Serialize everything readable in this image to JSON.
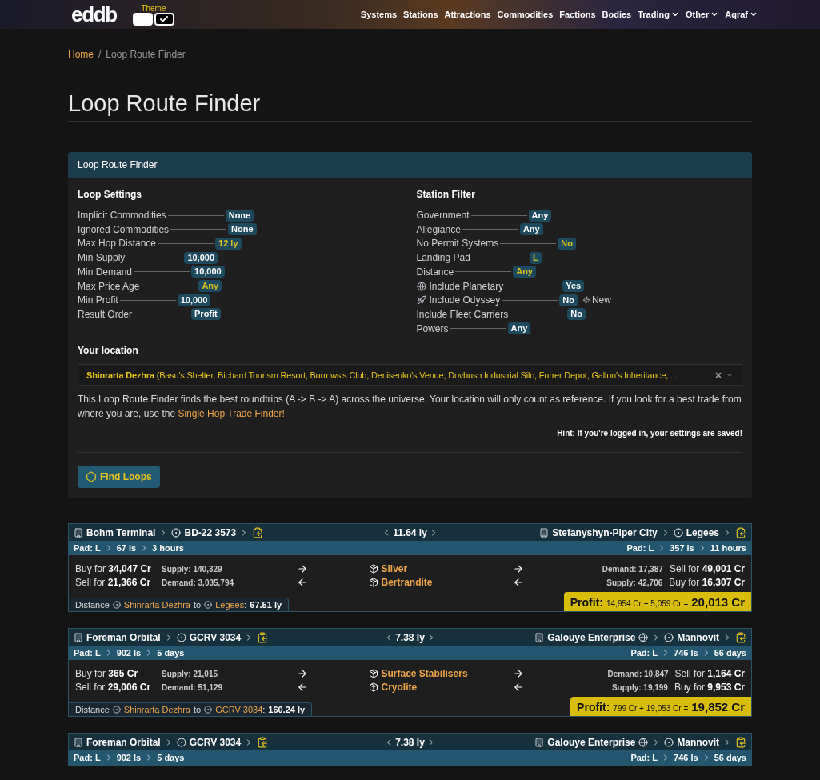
{
  "navbar": {
    "logo": "eddb",
    "theme": {
      "label": "Theme",
      "options": [
        {
          "selected": false
        },
        {
          "selected": true
        }
      ]
    },
    "items": [
      {
        "label": "Systems",
        "dropdown": false
      },
      {
        "label": "Stations",
        "dropdown": false
      },
      {
        "label": "Attractions",
        "dropdown": false
      },
      {
        "label": "Commodities",
        "dropdown": false
      },
      {
        "label": "Factions",
        "dropdown": false
      },
      {
        "label": "Bodies",
        "dropdown": false
      },
      {
        "label": "Trading",
        "dropdown": true
      },
      {
        "label": "Other",
        "dropdown": true
      },
      {
        "label": "Aqraf",
        "dropdown": true
      }
    ]
  },
  "breadcrumb": {
    "home": "Home",
    "separator": "/",
    "current": "Loop Route Finder"
  },
  "page_title": "Loop Route Finder",
  "panel": {
    "title": "Loop Route Finder",
    "loop_settings": {
      "heading": "Loop Settings",
      "rows": [
        {
          "label": "Implicit Commodities",
          "value": "None",
          "highlight": false
        },
        {
          "label": "Ignored Commodities",
          "value": "None",
          "highlight": false
        },
        {
          "label": "Max Hop Distance",
          "value": "12 ly",
          "highlight": true
        },
        {
          "label": "Min Supply",
          "value": "10,000",
          "highlight": false
        },
        {
          "label": "Min Demand",
          "value": "10,000",
          "highlight": false
        },
        {
          "label": "Max Price Age",
          "value": "Any",
          "highlight": true
        },
        {
          "label": "Min Profit",
          "value": "10,000",
          "highlight": false
        },
        {
          "label": "Result Order",
          "value": "Profit",
          "highlight": false
        }
      ]
    },
    "station_filter": {
      "heading": "Station Filter",
      "rows": [
        {
          "label": "Government",
          "value": "Any",
          "highlight": false
        },
        {
          "label": "Allegiance",
          "value": "Any",
          "highlight": false
        },
        {
          "label": "No Permit Systems",
          "value": "No",
          "highlight": true
        },
        {
          "label": "Landing Pad",
          "value": "L",
          "highlight": true
        },
        {
          "label": "Distance",
          "value": "Any",
          "highlight": true
        },
        {
          "label": "Include Planetary",
          "value": "Yes",
          "highlight": false,
          "kind": "planetary"
        },
        {
          "label": "Include Odyssey",
          "value": "No",
          "highlight": false,
          "kind": "odyssey",
          "note": "New"
        },
        {
          "label": "Include Fleet Carriers",
          "value": "No",
          "highlight": false
        },
        {
          "label": "Powers",
          "value": "Any",
          "highlight": false
        }
      ]
    },
    "location": {
      "label": "Your location",
      "value": "**Shinrarta Dezhra** (Basu's Shelter, Bichard Tourism Resort, Burrows's Club, Denisenko's Venue, Dovbush Industrial Silo, Furrer Depot, Gallun's Inheritance, ..."
    },
    "description": "This Loop Route Finder finds the best roundtrips (A -> B -> A) across the universe. Your location will only count as reference. If you look for a best trade from where you are, use the",
    "description_link": "Single Hop Trade Finder!",
    "hint": "Hint: If you're logged in, your settings are saved!",
    "button": "Find Loops"
  },
  "routes": [
    {
      "from": {
        "station": "Bohm Terminal",
        "planetary": false,
        "system": "BD-22 3573",
        "pad": "Pad: L",
        "distance": "67 ls",
        "age": "3 hours"
      },
      "hop": "11.64 ly",
      "to": {
        "station": "Stefanyshyn-Piper City",
        "planetary": false,
        "system": "Legees",
        "pad": "Pad: L",
        "distance": "357 ls",
        "age": "11 hours"
      },
      "trades": [
        {
          "left_price": "Buy for **34,047 Cr**",
          "left_stock": "Supply: 140,329",
          "commodity": "Silver",
          "right_stock": "Demand: 17,387",
          "right_price": "Sell for **49,001 Cr**"
        },
        {
          "left_price": "Sell for **21,366 Cr**",
          "left_stock": "Demand: 3,035,794",
          "commodity": "Bertrandite",
          "right_stock": "Supply: 42,706",
          "right_price": "Buy for **16,307 Cr**"
        }
      ],
      "reference": {
        "label": "Distance",
        "from": "Shinrarta Dezhra",
        "word": "to",
        "to": "Legees",
        "separator": ":",
        "value": "67.51 ly"
      },
      "profit": {
        "label": "Profit:",
        "breakdown": "14,954 Cr + 5,059 Cr =",
        "total": "20,013 Cr"
      }
    },
    {
      "from": {
        "station": "Foreman Orbital",
        "planetary": false,
        "system": "GCRV 3034",
        "pad": "Pad: L",
        "distance": "902 ls",
        "age": "5 days"
      },
      "hop": "7.38 ly",
      "to": {
        "station": "Galouye Enterprise",
        "planetary": true,
        "system": "Mannovit",
        "pad": "Pad: L",
        "distance": "746 ls",
        "age": "56 days"
      },
      "trades": [
        {
          "left_price": "Buy for **365 Cr**",
          "left_stock": "Supply: 21,015",
          "commodity": "Surface Stabilisers",
          "right_stock": "Demand: 10,847",
          "right_price": "Sell for **1,164 Cr**"
        },
        {
          "left_price": "Sell for **29,006 Cr**",
          "left_stock": "Demand: 51,129",
          "commodity": "Cryolite",
          "right_stock": "Supply: 19,199",
          "right_price": "Buy for **9,953 Cr**"
        }
      ],
      "reference": {
        "label": "Distance",
        "from": "Shinrarta Dezhra",
        "word": "to",
        "to": "GCRV 3034",
        "separator": ":",
        "value": "160.24 ly"
      },
      "profit": {
        "label": "Profit:",
        "breakdown": "799 Cr + 19,053 Cr =",
        "total": "19,852 Cr"
      }
    },
    {
      "from": {
        "station": "Foreman Orbital",
        "planetary": false,
        "system": "GCRV 3034",
        "pad": "Pad: L",
        "distance": "902 ls",
        "age": "5 days"
      },
      "hop": "7.38 ly",
      "to": {
        "station": "Galouye Enterprise",
        "planetary": true,
        "system": "Mannovit",
        "pad": "Pad: L",
        "distance": "746 ls",
        "age": "56 days"
      }
    }
  ]
}
